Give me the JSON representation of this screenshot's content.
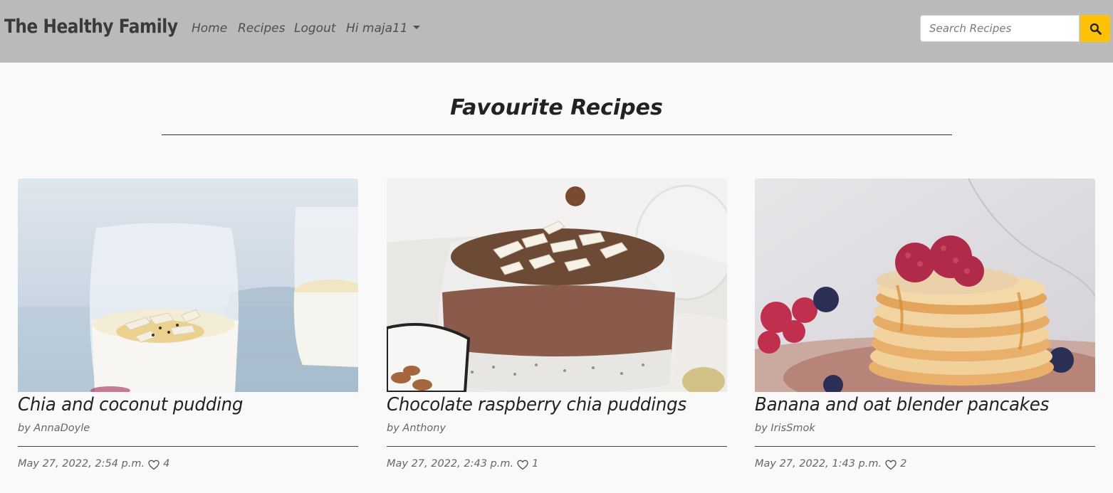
{
  "navbar": {
    "brand": "The Healthy Family",
    "links": [
      {
        "label": "Home"
      },
      {
        "label": "Recipes"
      },
      {
        "label": "Logout"
      }
    ],
    "user_menu_label": "Hi maja11",
    "search_placeholder": "Search Recipes",
    "search_icon": "search-icon"
  },
  "main": {
    "title": "Favourite Recipes"
  },
  "recipes": [
    {
      "title": "Chia and coconut pudding",
      "author": "by AnnaDoyle",
      "date": "May 27, 2022, 2:54 p.m.",
      "likes": "4"
    },
    {
      "title": "Chocolate raspberry chia puddings",
      "author": "by Anthony",
      "date": "May 27, 2022, 2:43 p.m.",
      "likes": "1"
    },
    {
      "title": "Banana and oat blender pancakes",
      "author": "by IrisSmok",
      "date": "May 27, 2022, 1:43 p.m.",
      "likes": "2"
    }
  ],
  "colors": {
    "navbar_bg": "#bababa",
    "search_button": "#ffc107",
    "page_bg": "#f9f9f9"
  }
}
